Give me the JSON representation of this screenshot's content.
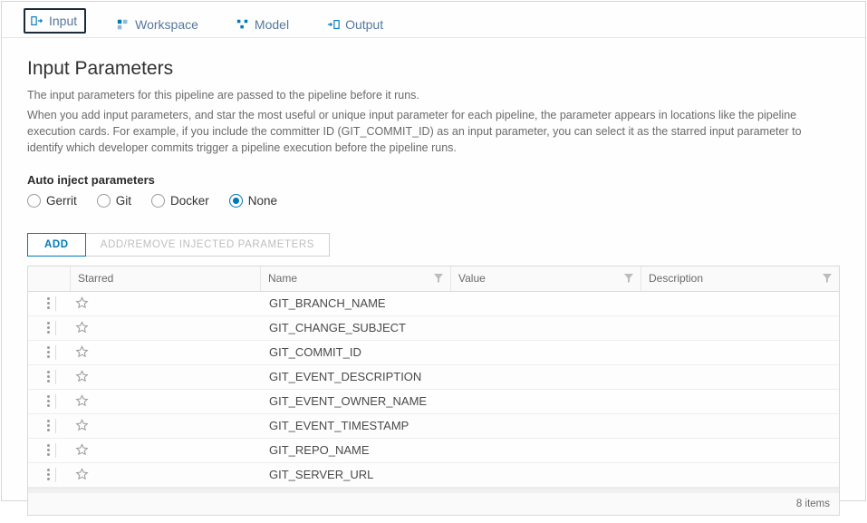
{
  "tabs": {
    "input": {
      "label": "Input"
    },
    "workspace": {
      "label": "Workspace"
    },
    "model": {
      "label": "Model"
    },
    "output": {
      "label": "Output"
    }
  },
  "page": {
    "title": "Input Parameters",
    "desc1": "The input parameters for this pipeline are passed to the pipeline before it runs.",
    "desc2": "When you add input parameters, and star the most useful or unique input parameter for each pipeline, the parameter appears in locations like the pipeline execution cards. For example, if you include the committer ID (GIT_COMMIT_ID) as an input parameter, you can select it as the starred input parameter to identify which developer commits trigger a pipeline execution before the pipeline runs."
  },
  "autoInject": {
    "label": "Auto inject parameters",
    "options": {
      "gerrit": "Gerrit",
      "git": "Git",
      "docker": "Docker",
      "none": "None"
    },
    "selected": "none"
  },
  "buttons": {
    "add": "ADD",
    "injected": "ADD/REMOVE INJECTED PARAMETERS"
  },
  "table": {
    "headers": {
      "starred": "Starred",
      "name": "Name",
      "value": "Value",
      "description": "Description"
    },
    "rows": [
      {
        "name": "GIT_BRANCH_NAME",
        "value": "",
        "description": "",
        "starred": false
      },
      {
        "name": "GIT_CHANGE_SUBJECT",
        "value": "",
        "description": "",
        "starred": false
      },
      {
        "name": "GIT_COMMIT_ID",
        "value": "",
        "description": "",
        "starred": false
      },
      {
        "name": "GIT_EVENT_DESCRIPTION",
        "value": "",
        "description": "",
        "starred": false
      },
      {
        "name": "GIT_EVENT_OWNER_NAME",
        "value": "",
        "description": "",
        "starred": false
      },
      {
        "name": "GIT_EVENT_TIMESTAMP",
        "value": "",
        "description": "",
        "starred": false
      },
      {
        "name": "GIT_REPO_NAME",
        "value": "",
        "description": "",
        "starred": false
      },
      {
        "name": "GIT_SERVER_URL",
        "value": "",
        "description": "",
        "starred": false
      }
    ],
    "footer_count": "8 items"
  }
}
